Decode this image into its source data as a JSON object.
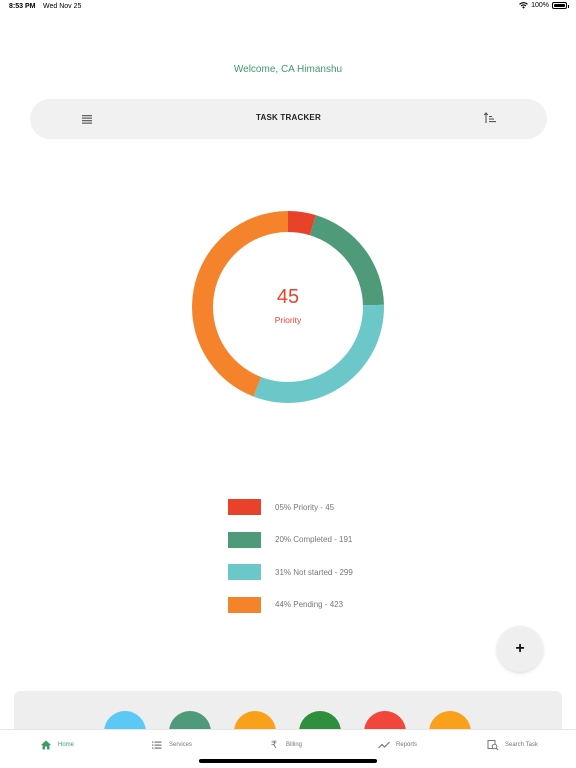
{
  "status_bar": {
    "time": "8:53 PM",
    "date": "Wed Nov 25",
    "battery": "100%",
    "battery_level": 1.0
  },
  "welcome": "Welcome, CA Himanshu",
  "header": {
    "title": "TASK TRACKER",
    "menu_icon": "list-icon",
    "sort_icon": "sort-icon"
  },
  "chart_data": {
    "type": "pie",
    "donut": true,
    "center_value": "45",
    "center_label": "Priority",
    "slices": [
      {
        "name": "Priority",
        "value": 45,
        "percent": 5,
        "color": "#e8432a"
      },
      {
        "name": "Completed",
        "value": 191,
        "percent": 20,
        "color": "#4f9a78"
      },
      {
        "name": "Not started",
        "value": 299,
        "percent": 31,
        "color": "#6cc7c8"
      },
      {
        "name": "Pending",
        "value": 423,
        "percent": 44,
        "color": "#f5832c"
      }
    ],
    "legend": [
      "05% Priority - 45",
      "20% Completed - 191",
      "31% Not started - 299",
      "44% Pending - 423"
    ]
  },
  "fab": {
    "label": "+"
  },
  "quick_actions": {
    "colors": [
      "#5bc8f5",
      "#4f9a78",
      "#f9a11b",
      "#2f8f3d",
      "#f2463b",
      "#f9a11b"
    ]
  },
  "tabs": [
    {
      "label": "Home",
      "icon": "home-icon",
      "active": true
    },
    {
      "label": "Services",
      "icon": "list-icon",
      "active": false
    },
    {
      "label": "Billing",
      "icon": "rupee-icon",
      "active": false
    },
    {
      "label": "Reports",
      "icon": "trend-icon",
      "active": false
    },
    {
      "label": "Search Task",
      "icon": "search-task-icon",
      "active": false
    }
  ]
}
